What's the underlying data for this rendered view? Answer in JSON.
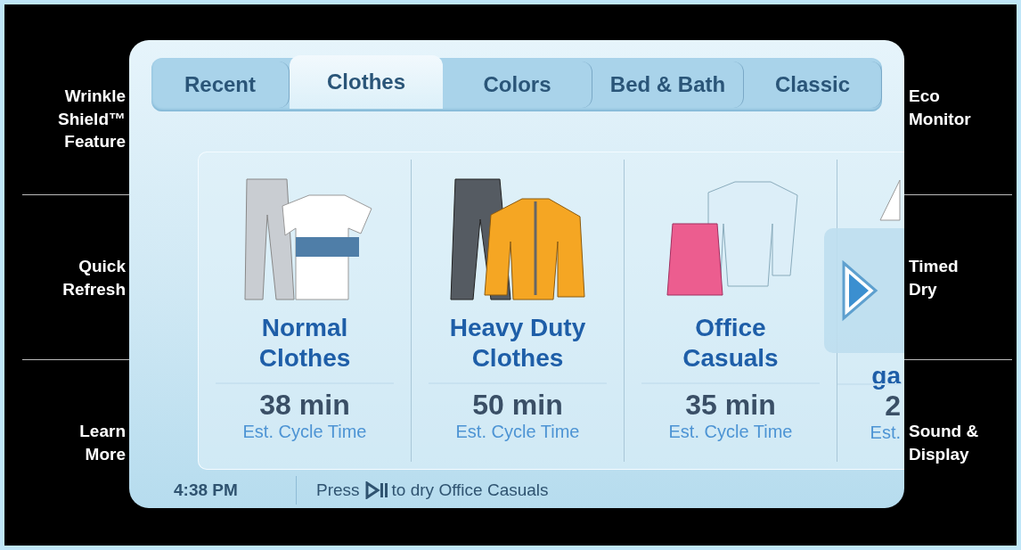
{
  "left_buttons": [
    {
      "label": "Wrinkle\nShield™\nFeature"
    },
    {
      "label": "Quick\nRefresh"
    },
    {
      "label": "Learn\nMore"
    }
  ],
  "tabs": [
    {
      "label": "Recent",
      "selected": false
    },
    {
      "label": "Clothes",
      "selected": true
    },
    {
      "label": "Colors",
      "selected": false
    },
    {
      "label": "Bed & Bath",
      "selected": false
    },
    {
      "label": "Classic",
      "selected": false
    }
  ],
  "cycles": [
    {
      "kind": "pants-shirt",
      "name": "Normal\nClothes",
      "time": "38 min",
      "caption": "Est. Cycle Time"
    },
    {
      "kind": "pants-jacket",
      "name": "Heavy Duty\nClothes",
      "time": "50 min",
      "caption": "Est. Cycle Time"
    },
    {
      "kind": "skirt-shirt",
      "name": "Office\nCasuals",
      "time": "35 min",
      "caption": "Est. Cycle Time"
    },
    {
      "kind": "partial",
      "name": "ga",
      "time": "2",
      "caption": "Est."
    }
  ],
  "status_bar": {
    "time": "4:38 PM",
    "message_before": "Press",
    "message_after": "to dry Office Casuals"
  },
  "right_buttons": [
    {
      "label": "Eco\nMonitor"
    },
    {
      "label": "Timed\nDry"
    },
    {
      "label": "Sound &\nDisplay"
    }
  ]
}
